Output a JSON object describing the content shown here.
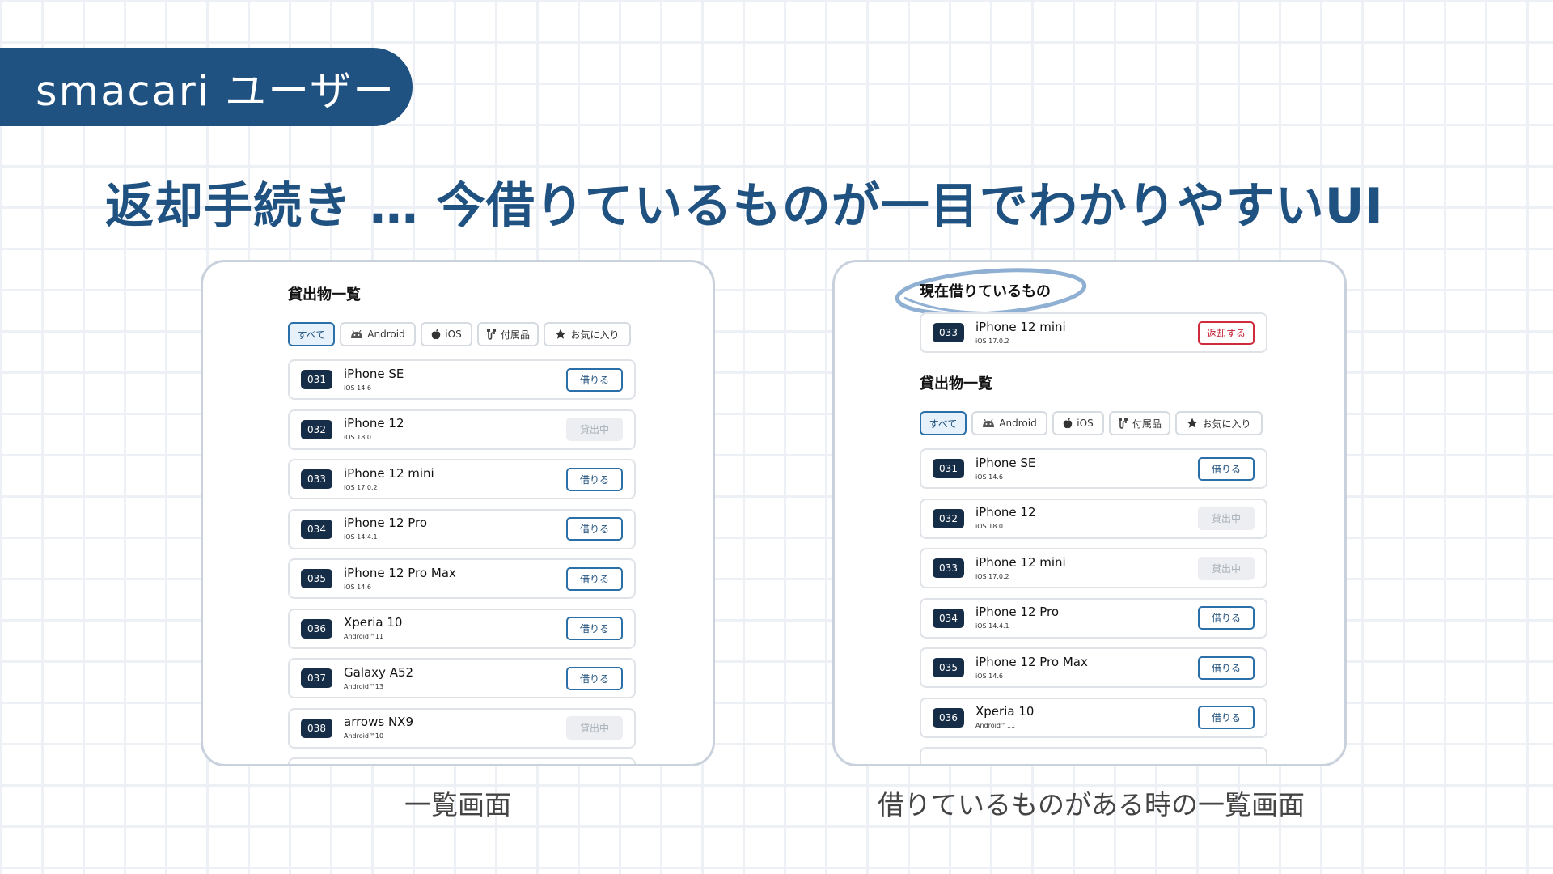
{
  "tag": {
    "label": "smacari ユーザー"
  },
  "headline": "返却手続き … 今借りているものが一目でわかりやすいUI",
  "filters": [
    {
      "label": "すべて",
      "icon": "",
      "active": true
    },
    {
      "label": "Android",
      "icon": "android-icon",
      "active": false
    },
    {
      "label": "iOS",
      "icon": "apple-icon",
      "active": false
    },
    {
      "label": "付属品",
      "icon": "cable-icon",
      "active": false
    },
    {
      "label": "お気に入り",
      "icon": "star-icon",
      "active": false
    }
  ],
  "left_screen": {
    "caption": "一覧画面",
    "list_title": "貸出物一覧",
    "items": [
      {
        "id": "031",
        "name": "iPhone SE",
        "os": "iOS 14.6",
        "action": "借りる",
        "state": "borrow"
      },
      {
        "id": "032",
        "name": "iPhone 12",
        "os": "iOS 18.0",
        "action": "貸出中",
        "state": "out"
      },
      {
        "id": "033",
        "name": "iPhone 12 mini",
        "os": "iOS 17.0.2",
        "action": "借りる",
        "state": "borrow"
      },
      {
        "id": "034",
        "name": "iPhone 12 Pro",
        "os": "iOS 14.4.1",
        "action": "借りる",
        "state": "borrow"
      },
      {
        "id": "035",
        "name": "iPhone 12 Pro Max",
        "os": "iOS 14.6",
        "action": "借りる",
        "state": "borrow"
      },
      {
        "id": "036",
        "name": "Xperia 10",
        "os": "Android™11",
        "action": "借りる",
        "state": "borrow"
      },
      {
        "id": "037",
        "name": "Galaxy A52",
        "os": "Android™13",
        "action": "借りる",
        "state": "borrow"
      },
      {
        "id": "038",
        "name": "arrows NX9",
        "os": "Android™10",
        "action": "貸出中",
        "state": "out"
      }
    ]
  },
  "right_screen": {
    "caption": "借りているものがある時の一覧画面",
    "current_title": "現在借りているもの",
    "current_items": [
      {
        "id": "033",
        "name": "iPhone 12 mini",
        "os": "iOS 17.0.2",
        "action": "返却する",
        "state": "return"
      }
    ],
    "list_title": "貸出物一覧",
    "items": [
      {
        "id": "031",
        "name": "iPhone SE",
        "os": "iOS 14.6",
        "action": "借りる",
        "state": "borrow"
      },
      {
        "id": "032",
        "name": "iPhone 12",
        "os": "iOS 18.0",
        "action": "貸出中",
        "state": "out"
      },
      {
        "id": "033",
        "name": "iPhone 12 mini",
        "os": "iOS 17.0.2",
        "action": "貸出中",
        "state": "out"
      },
      {
        "id": "034",
        "name": "iPhone 12 Pro",
        "os": "iOS 14.4.1",
        "action": "借りる",
        "state": "borrow"
      },
      {
        "id": "035",
        "name": "iPhone 12 Pro Max",
        "os": "iOS 14.6",
        "action": "借りる",
        "state": "borrow"
      },
      {
        "id": "036",
        "name": "Xperia 10",
        "os": "Android™11",
        "action": "借りる",
        "state": "borrow"
      }
    ]
  },
  "colors": {
    "brand": "#1f5281",
    "badge": "#162d48",
    "borrow": "#2a6fa8",
    "return": "#d02a3d",
    "highlight": "#8fb0d2"
  }
}
